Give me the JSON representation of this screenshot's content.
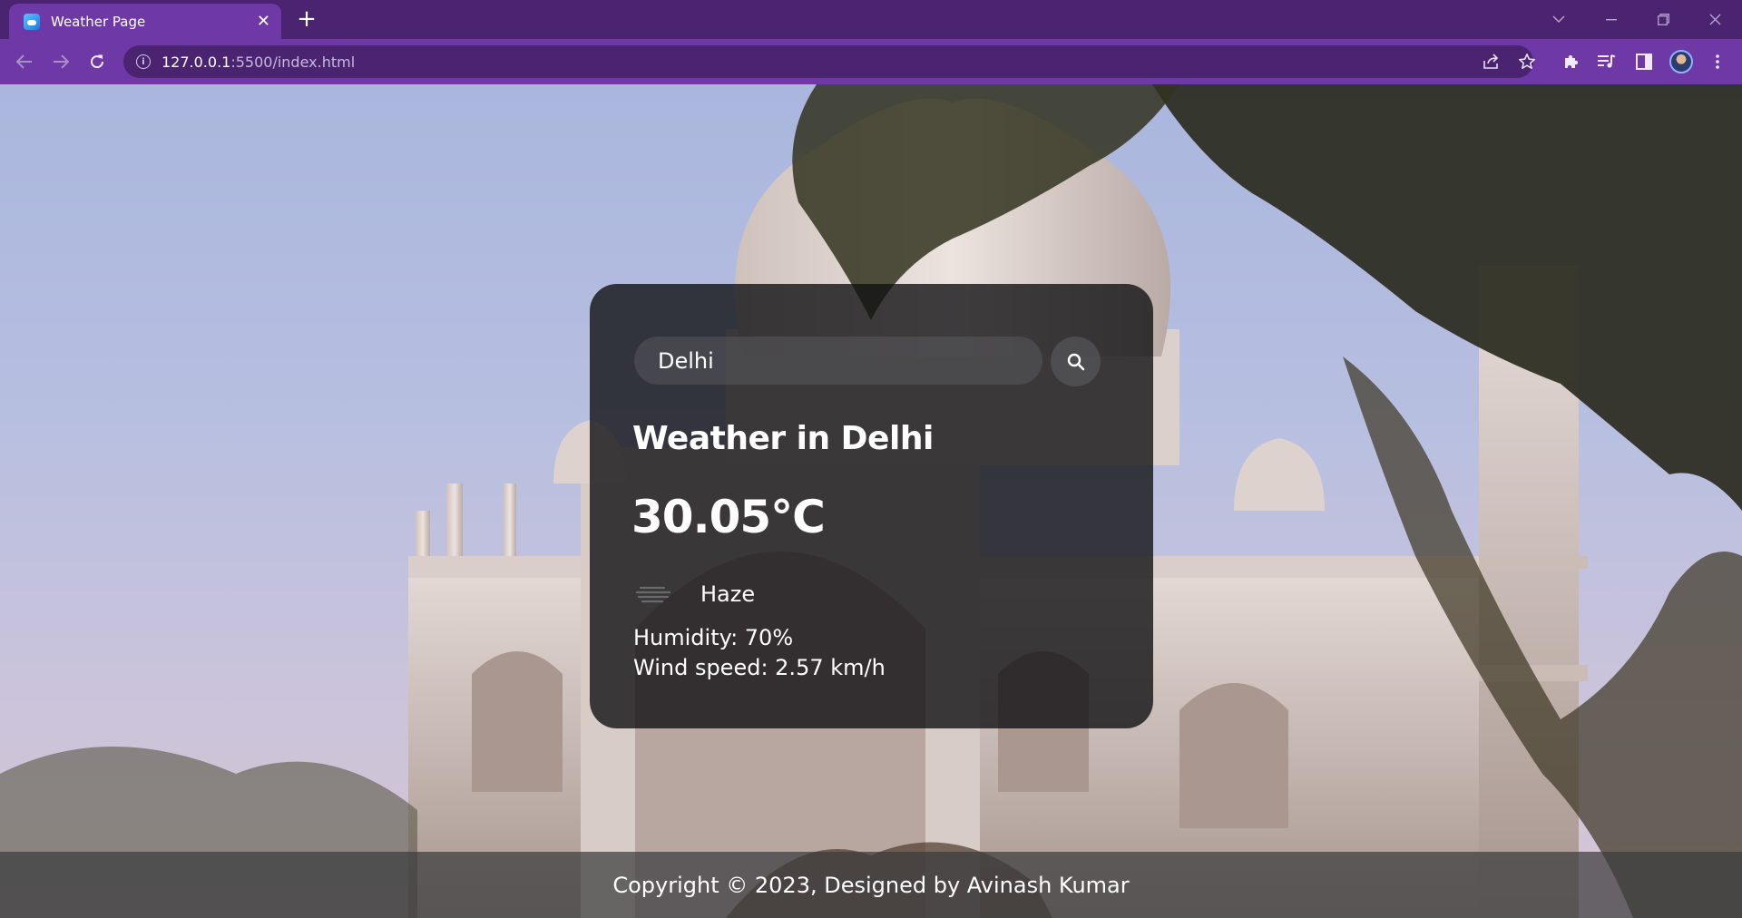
{
  "browser": {
    "tab_title": "Weather Page",
    "tab_close": "✕",
    "new_tab": "+",
    "url_host": "127.0.0.1",
    "url_path": ":5500/index.html"
  },
  "weather": {
    "search_value": "Delhi",
    "heading": "Weather in Delhi",
    "temperature": "30.05°C",
    "description": "Haze",
    "humidity": "Humidity: 70%",
    "wind": "Wind speed: 2.57 km/h"
  },
  "footer": {
    "text": "Copyright © 2023, Designed by Avinash Kumar"
  }
}
